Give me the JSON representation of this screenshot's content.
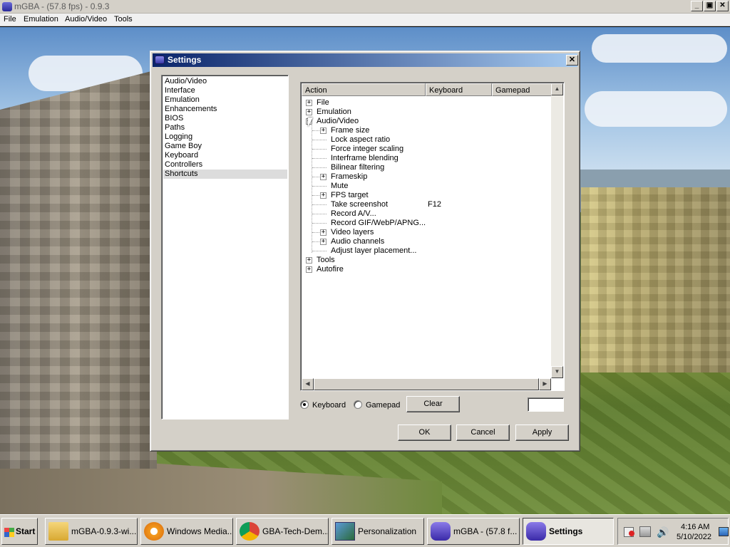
{
  "main_window": {
    "title": "mGBA -  (57.8 fps) - 0.9.3",
    "menu": [
      "File",
      "Emulation",
      "Audio/Video",
      "Tools"
    ]
  },
  "settings": {
    "title": "Settings",
    "categories": [
      "Audio/Video",
      "Interface",
      "Emulation",
      "Enhancements",
      "BIOS",
      "Paths",
      "Logging",
      "Game Boy",
      "Keyboard",
      "Controllers",
      "Shortcuts"
    ],
    "selected_category": "Shortcuts",
    "columns": [
      "Action",
      "Keyboard",
      "Gamepad"
    ],
    "tree": [
      {
        "label": "File",
        "keyboard": ""
      },
      {
        "label": "Emulation",
        "keyboard": ""
      },
      {
        "label": "Audio/Video",
        "keyboard": ""
      },
      {
        "label": "Frame size",
        "keyboard": ""
      },
      {
        "label": "Lock aspect ratio",
        "keyboard": ""
      },
      {
        "label": "Force integer scaling",
        "keyboard": ""
      },
      {
        "label": "Interframe blending",
        "keyboard": ""
      },
      {
        "label": "Bilinear filtering",
        "keyboard": ""
      },
      {
        "label": "Frameskip",
        "keyboard": ""
      },
      {
        "label": "Mute",
        "keyboard": ""
      },
      {
        "label": "FPS target",
        "keyboard": ""
      },
      {
        "label": "Take screenshot",
        "keyboard": "F12"
      },
      {
        "label": "Record A/V...",
        "keyboard": ""
      },
      {
        "label": "Record GIF/WebP/APNG...",
        "keyboard": ""
      },
      {
        "label": "Video layers",
        "keyboard": ""
      },
      {
        "label": "Audio channels",
        "keyboard": ""
      },
      {
        "label": "Adjust layer placement...",
        "keyboard": ""
      },
      {
        "label": "Tools",
        "keyboard": ""
      },
      {
        "label": "Autofire",
        "keyboard": ""
      }
    ],
    "input_mode": {
      "keyboard_label": "Keyboard",
      "gamepad_label": "Gamepad",
      "selected": "Keyboard"
    },
    "clear_label": "Clear",
    "ok_label": "OK",
    "cancel_label": "Cancel",
    "apply_label": "Apply"
  },
  "taskbar": {
    "start_label": "Start",
    "items": [
      {
        "label": "mGBA-0.9.3-wi...",
        "icon": "folder-icon"
      },
      {
        "label": "Windows Media...",
        "icon": "media-player-icon"
      },
      {
        "label": "GBA-Tech-Dem...",
        "icon": "chrome-icon"
      },
      {
        "label": "Personalization",
        "icon": "personalization-icon"
      },
      {
        "label": "mGBA -  (57.8 f...",
        "icon": "mgba-icon"
      },
      {
        "label": "Settings",
        "icon": "mgba-icon"
      }
    ],
    "clock_time": "4:16 AM",
    "clock_date": "5/10/2022"
  }
}
